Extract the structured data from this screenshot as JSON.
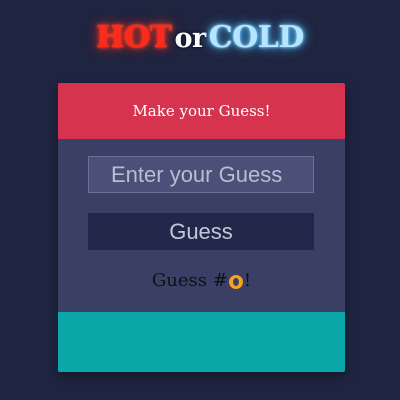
{
  "logo": {
    "hot": "HOT",
    "or": "or",
    "cold": "COLD"
  },
  "card": {
    "header": "Make your Guess!",
    "input_placeholder": "Enter your Guess",
    "input_value": "",
    "button_label": "Guess",
    "count_prefix": "Guess #",
    "count_value": "0",
    "count_suffix": "!"
  },
  "colors": {
    "background": "#1f2440",
    "header": "#d6344e",
    "card": "#3a3f66",
    "footer": "#0aa6a8",
    "hot": "#ff2a1a",
    "cold": "#b9e4ff",
    "badge": "#f7a31b"
  }
}
